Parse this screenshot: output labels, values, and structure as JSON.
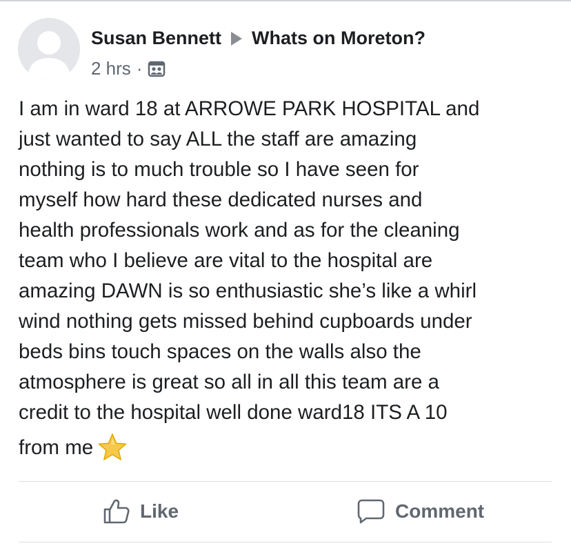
{
  "post": {
    "author": "Susan Bennett",
    "group": "Whats on Moreton?",
    "time": "2 hrs",
    "separator": "·",
    "audience_icon": "group-audience-icon",
    "body_lines": [
      "I am in ward 18 at ARROWE PARK HOSPITAL and",
      "just wanted to say ALL the staff are amazing",
      "nothing is to much trouble so I have seen for",
      "myself how hard these dedicated nurses and",
      "health professionals work and as for the cleaning",
      "team who I believe are vital to the hospital are",
      "amazing DAWN is so enthusiastic she’s like a whirl",
      "wind nothing gets missed behind cupboards under",
      "beds bins touch spaces on the walls  also the",
      "atmosphere is great so all in all this team are a",
      "credit  to the hospital well done ward18 ITS A 10",
      "from me"
    ],
    "emoji": "star-icon"
  },
  "actions": {
    "like_label": "Like",
    "comment_label": "Comment"
  },
  "colors": {
    "text": "#1c1e21",
    "secondary": "#606770",
    "divider": "#dadde1",
    "star_fill": "#f7c948",
    "star_stroke": "#e0a800"
  }
}
